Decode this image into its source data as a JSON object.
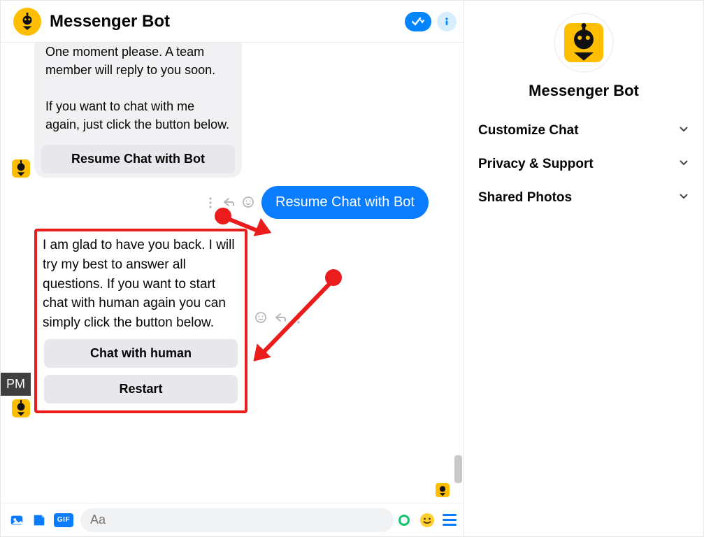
{
  "header": {
    "title": "Messenger Bot",
    "badge_icon": "checkmark-dropdown",
    "info_icon": "info"
  },
  "bot_msg_1": {
    "text": "One moment please.  A team member will reply to you soon.\n\nIf you want to chat with me again, just click the button below.",
    "button_resume": "Resume Chat with Bot"
  },
  "user_msg": {
    "text": "Resume Chat with Bot"
  },
  "bot_msg_2": {
    "text": "I am glad to have you back. I will try my best to answer all questions. If you want to start chat with human again you can simply click the button below.",
    "button_human": "Chat with human",
    "button_restart": "Restart"
  },
  "sidebar": {
    "title": "Messenger Bot",
    "sections": [
      {
        "label": "Customize Chat"
      },
      {
        "label": "Privacy & Support"
      },
      {
        "label": "Shared Photos"
      }
    ]
  },
  "composer": {
    "placeholder": "Aa",
    "gif_label": "GIF"
  },
  "gutter": {
    "pm_label": "PM"
  }
}
